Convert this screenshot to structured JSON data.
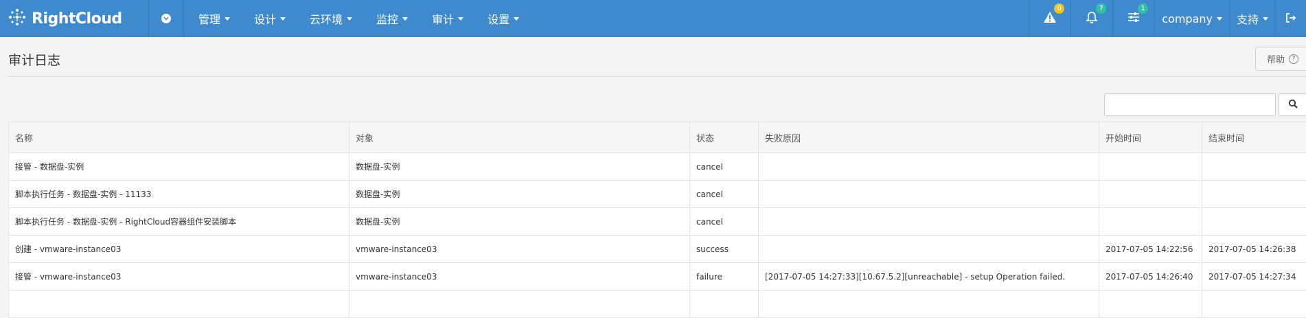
{
  "header": {
    "brand": "RightCloud",
    "nav": [
      {
        "label": "管理"
      },
      {
        "label": "设计"
      },
      {
        "label": "云环境"
      },
      {
        "label": "监控"
      },
      {
        "label": "审计"
      },
      {
        "label": "设置"
      }
    ],
    "alerts_badge": "0",
    "notifications_badge": "7",
    "tasks_badge": "1",
    "company_label": "company",
    "support_label": "支持",
    "colors": {
      "bar": "#3f8ace",
      "badge_yellow": "#f4c315",
      "badge_teal": "#2ec4a6"
    }
  },
  "page": {
    "title": "审计日志",
    "help_label": "帮助",
    "search": {
      "value": "",
      "placeholder": ""
    }
  },
  "table": {
    "columns": [
      "名称",
      "对象",
      "状态",
      "失败原因",
      "开始时间",
      "结束时间"
    ],
    "rows": [
      [
        "接管 - 数据盘-实例",
        "数据盘-实例",
        "cancel",
        "",
        "",
        ""
      ],
      [
        "脚本执行任务 - 数据盘-实例 - 11133",
        "数据盘-实例",
        "cancel",
        "",
        "",
        ""
      ],
      [
        "脚本执行任务 - 数据盘-实例 - RightCloud容器组件安装脚本",
        "数据盘-实例",
        "cancel",
        "",
        "",
        ""
      ],
      [
        "创建 - vmware-instance03",
        "vmware-instance03",
        "success",
        "",
        "2017-07-05 14:22:56",
        "2017-07-05 14:26:38"
      ],
      [
        "接管 - vmware-instance03",
        "vmware-instance03",
        "failure",
        "[2017-07-05 14:27:33][10.67.5.2][unreachable] - setup Operation failed.",
        "2017-07-05 14:26:40",
        "2017-07-05 14:27:34"
      ],
      [
        "",
        "",
        "",
        "",
        "",
        ""
      ]
    ]
  }
}
